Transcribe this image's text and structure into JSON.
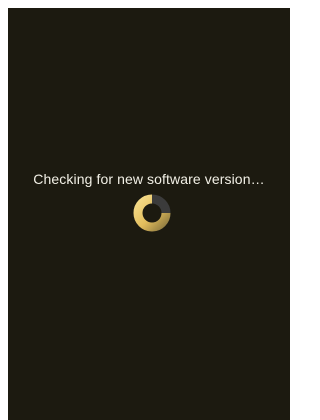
{
  "update_check": {
    "message": "Checking for new software version…",
    "status_icon": "loading-spinner-icon"
  },
  "colors": {
    "background": "#1c1a10",
    "text": "#f2f0e6",
    "spinner_track": "#3a3a3a",
    "spinner_accent": "#e2bd5c"
  }
}
